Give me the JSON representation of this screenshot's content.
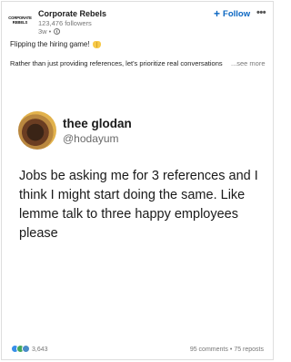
{
  "post": {
    "author_name": "Corporate Rebels",
    "logo_line1": "CORPORATE",
    "logo_line2": "REBELS",
    "followers": "123,476 followers",
    "time_ago": "3w",
    "time_separator": "•",
    "follow_label": "Follow",
    "follow_plus": "+",
    "more_menu": "•••",
    "text_line1": "Flipping the hiring game!",
    "text_line2": "Rather than just providing references, let's prioritize real conversations",
    "see_more": "...see more"
  },
  "tweet": {
    "display_name": "thee glodan",
    "handle": "@hodayum",
    "text": "Jobs be asking me for 3 references and I think I might start doing the same. Like lemme talk to three happy employees please"
  },
  "footer": {
    "reaction_count": "3,643",
    "comments": "95 comments",
    "separator": "•",
    "reposts": "75 reposts"
  },
  "colors": {
    "accent": "#0a66c2",
    "like": "#378fe9",
    "celebrate": "#44a75c"
  }
}
